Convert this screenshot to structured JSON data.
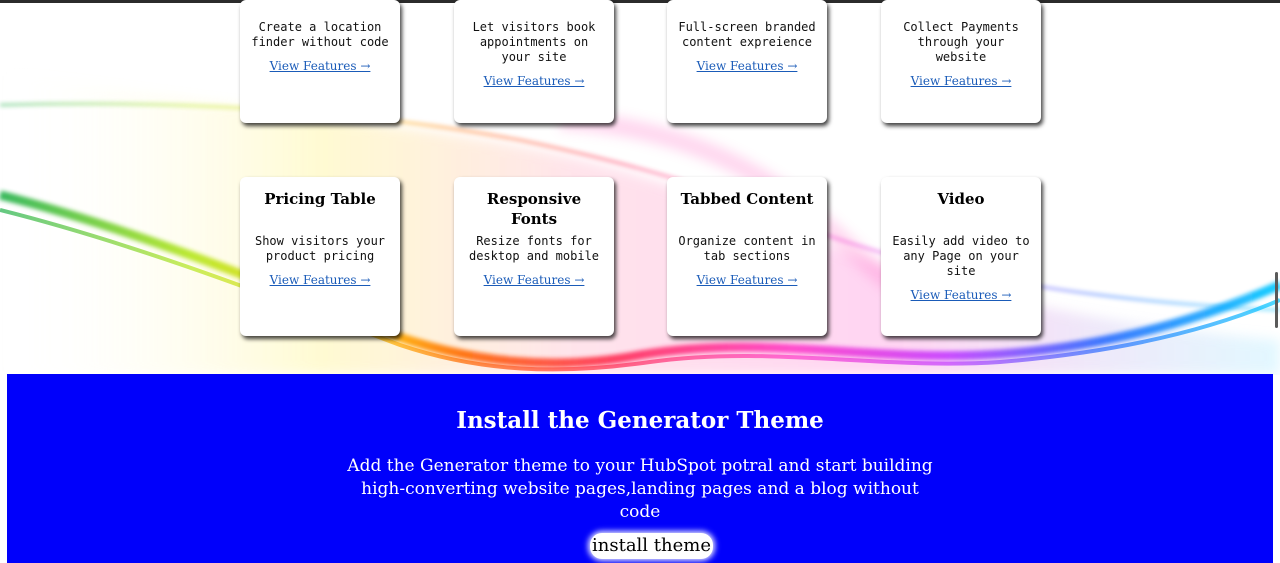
{
  "features_row1": [
    {
      "description": "Create a location finder without code",
      "link": "View Features →"
    },
    {
      "description": "Let visitors book appointments on your site",
      "link": "View Features →"
    },
    {
      "description": "Full-screen branded content expreience",
      "link": "View Features →"
    },
    {
      "description": "Collect Payments through your website",
      "link": "View Features →"
    }
  ],
  "features_row2": [
    {
      "title": "Pricing Table",
      "description": "Show visitors your product pricing",
      "link": "View Features →"
    },
    {
      "title": "Responsive Fonts",
      "description": "Resize fonts for desktop and mobile",
      "link": "View Features →"
    },
    {
      "title": "Tabbed Content",
      "description": "Organize content in tab sections",
      "link": "View Features →"
    },
    {
      "title": "Video",
      "description": "Easily add video to any Page on your site",
      "link": "View Features →"
    }
  ],
  "install": {
    "title": "Install the Generator Theme",
    "description": "Add the Generator theme to your HubSpot potral and start building high-converting website pages,landing pages and a blog without code",
    "button_label": "install theme"
  },
  "colors": {
    "install_background": "#0000fb",
    "link": "#1a5bb8"
  },
  "icons": {
    "link_arrow": "right-arrow-icon"
  }
}
